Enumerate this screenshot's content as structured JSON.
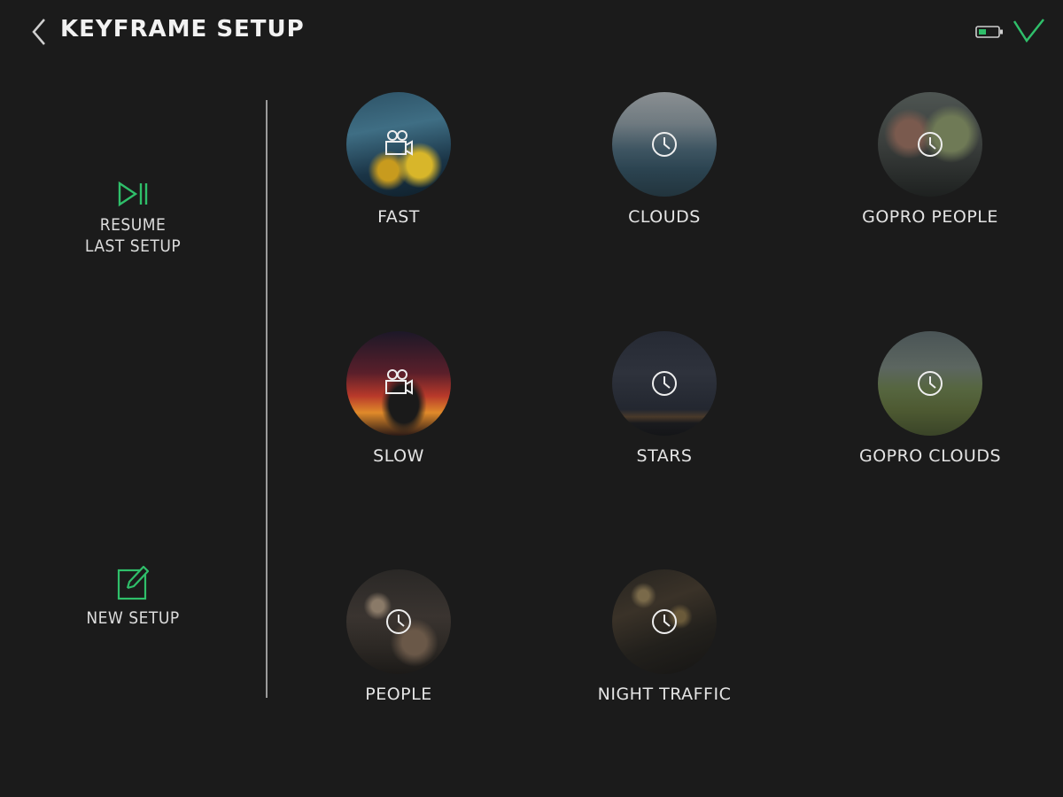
{
  "header": {
    "title": "KEYFRAME SETUP",
    "icons": {
      "back": "chevron-left-icon",
      "battery": "battery-icon",
      "confirm": "checkmark-icon"
    },
    "accent_color": "#2fbf6a"
  },
  "sidebar": {
    "resume": {
      "label": "RESUME\nLAST SETUP",
      "icon": "play-pause-icon"
    },
    "new_setup": {
      "label": "NEW SETUP",
      "icon": "edit-icon"
    }
  },
  "presets": [
    {
      "label": "FAST",
      "icon": "video-camera-icon"
    },
    {
      "label": "CLOUDS",
      "icon": "clock-icon"
    },
    {
      "label": "GOPRO PEOPLE",
      "icon": "clock-icon"
    },
    {
      "label": "SLOW",
      "icon": "video-camera-icon"
    },
    {
      "label": "STARS",
      "icon": "clock-icon"
    },
    {
      "label": "GOPRO CLOUDS",
      "icon": "clock-icon"
    },
    {
      "label": "PEOPLE",
      "icon": "clock-icon"
    },
    {
      "label": "NIGHT TRAFFIC",
      "icon": "clock-icon"
    }
  ]
}
